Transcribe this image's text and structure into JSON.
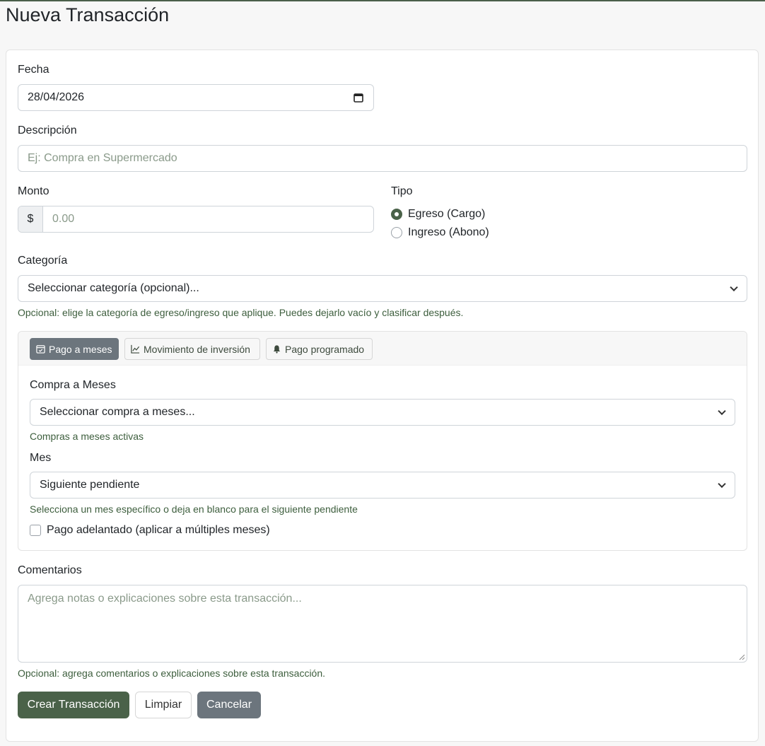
{
  "page": {
    "title": "Nueva Transacción"
  },
  "form": {
    "fecha": {
      "label": "Fecha",
      "value": "28/04/2026"
    },
    "descripcion": {
      "label": "Descripción",
      "placeholder": "Ej: Compra en Supermercado"
    },
    "monto": {
      "label": "Monto",
      "prefix": "$",
      "placeholder": "0.00"
    },
    "tipo": {
      "label": "Tipo",
      "options": [
        {
          "label": "Egreso (Cargo)",
          "selected": true
        },
        {
          "label": "Ingreso (Abono)",
          "selected": false
        }
      ]
    },
    "categoria": {
      "label": "Categoría",
      "value": "Seleccionar categoría (opcional)...",
      "help": "Opcional: elige la categoría de egreso/ingreso que aplique. Puedes dejarlo vacío y clasificar después."
    },
    "tabs": [
      {
        "label": "Pago a meses",
        "icon": "calendar-check-icon",
        "active": true
      },
      {
        "label": "Movimiento de inversión",
        "icon": "chart-line-icon",
        "active": false
      },
      {
        "label": "Pago programado",
        "icon": "bell-icon",
        "active": false
      }
    ],
    "compra_meses": {
      "label": "Compra a Meses",
      "value": "Seleccionar compra a meses...",
      "help": "Compras a meses activas"
    },
    "mes": {
      "label": "Mes",
      "value": "Siguiente pendiente",
      "help": "Selecciona un mes específico o deja en blanco para el siguiente pendiente"
    },
    "pago_adelantado": {
      "label": "Pago adelantado (aplicar a múltiples meses)",
      "checked": false
    },
    "comentarios": {
      "label": "Comentarios",
      "placeholder": "Agrega notas o explicaciones sobre esta transacción...",
      "help": "Opcional: agrega comentarios o explicaciones sobre esta transacción."
    }
  },
  "actions": {
    "create": "Crear Transacción",
    "clear": "Limpiar",
    "cancel": "Cancelar"
  },
  "colors": {
    "primary": "#4a6249",
    "secondary": "#6c757d",
    "help_text": "#3d5e3d"
  }
}
